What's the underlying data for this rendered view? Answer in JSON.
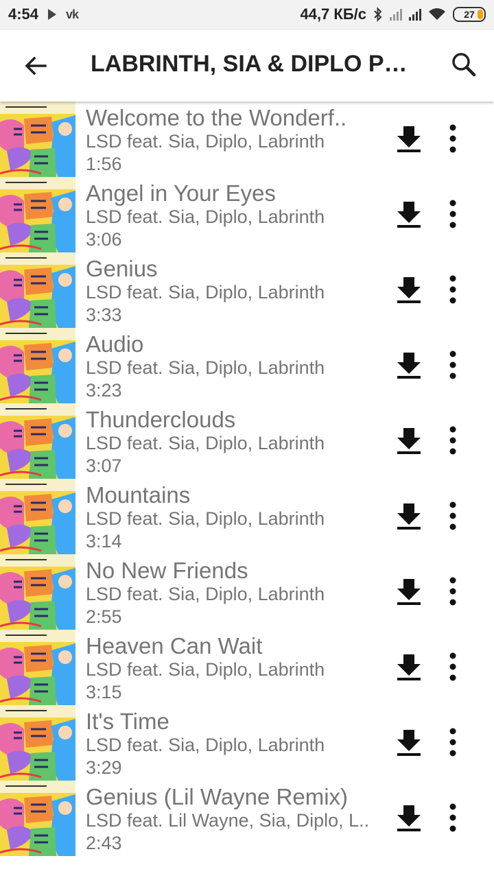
{
  "status_bar": {
    "time": "4:54",
    "network_speed": "44,7 КБ/с",
    "battery_level": "27",
    "icons": [
      "play-icon",
      "vk-icon",
      "bluetooth-icon",
      "signal-icon",
      "signal-icon",
      "wifi-icon",
      "battery-icon"
    ]
  },
  "app_bar": {
    "title": "LABRINTH, SIA & DIPLO PR...",
    "back_icon": "arrow-back-icon",
    "search_icon": "search-icon"
  },
  "colors": {
    "text_secondary": "#757575",
    "icon": "#111111",
    "status_bar_bg": "#f2f2f2",
    "battery_fill": "#f4a300"
  },
  "tracks": [
    {
      "title": "Welcome to the Wonderf..",
      "artist": "LSD feat. Sia, Diplo, Labrinth",
      "duration": "1:56"
    },
    {
      "title": "Angel in Your Eyes",
      "artist": "LSD feat. Sia, Diplo, Labrinth",
      "duration": "3:06"
    },
    {
      "title": "Genius",
      "artist": "LSD feat. Sia, Diplo, Labrinth",
      "duration": "3:33"
    },
    {
      "title": "Audio",
      "artist": "LSD feat. Sia, Diplo, Labrinth",
      "duration": "3:23"
    },
    {
      "title": "Thunderclouds",
      "artist": "LSD feat. Sia, Diplo, Labrinth",
      "duration": "3:07"
    },
    {
      "title": "Mountains",
      "artist": "LSD feat. Sia, Diplo, Labrinth",
      "duration": "3:14"
    },
    {
      "title": "No New Friends",
      "artist": "LSD feat. Sia, Diplo, Labrinth",
      "duration": "2:55"
    },
    {
      "title": "Heaven Can Wait",
      "artist": "LSD feat. Sia, Diplo, Labrinth",
      "duration": "3:15"
    },
    {
      "title": "It's Time",
      "artist": "LSD feat. Sia, Diplo, Labrinth",
      "duration": "3:29"
    },
    {
      "title": "Genius (Lil Wayne Remix)",
      "artist": "LSD feat. Lil Wayne, Sia, Diplo, L..",
      "duration": "2:43"
    }
  ]
}
